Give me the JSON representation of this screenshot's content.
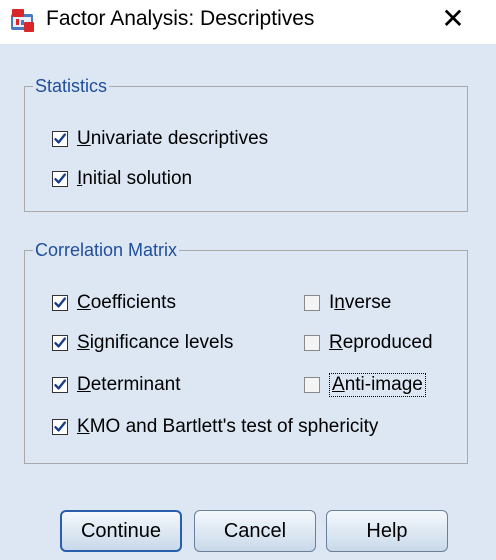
{
  "window": {
    "title": "Factor Analysis: Descriptives",
    "close_glyph": "✕",
    "icon": "spss-dialog-icon"
  },
  "statistics": {
    "legend": "Statistics",
    "items": [
      {
        "label": "Univariate descriptives",
        "checked": true,
        "mnemonic": "U"
      },
      {
        "label": "Initial solution",
        "checked": true,
        "mnemonic": "I"
      }
    ]
  },
  "correlation": {
    "legend": "Correlation Matrix",
    "items": [
      {
        "label": "Coefficients",
        "checked": true,
        "mnemonic": "C"
      },
      {
        "label": "Inverse",
        "checked": false,
        "mnemonic": "n"
      },
      {
        "label": "Significance levels",
        "checked": true,
        "mnemonic": "S"
      },
      {
        "label": "Reproduced",
        "checked": false,
        "mnemonic": "R"
      },
      {
        "label": "Determinant",
        "checked": true,
        "mnemonic": "D"
      },
      {
        "label": "Anti-image",
        "checked": false,
        "mnemonic": "A",
        "focused": true
      },
      {
        "label": "KMO and Bartlett's test of sphericity",
        "checked": true,
        "mnemonic": "K"
      }
    ]
  },
  "buttons": {
    "continue": "Continue",
    "cancel": "Cancel",
    "help": "Help"
  },
  "colors": {
    "client_bg": "#dde7f3",
    "legend_text": "#1f4e9a",
    "check_mark": "#1a3e8c"
  }
}
